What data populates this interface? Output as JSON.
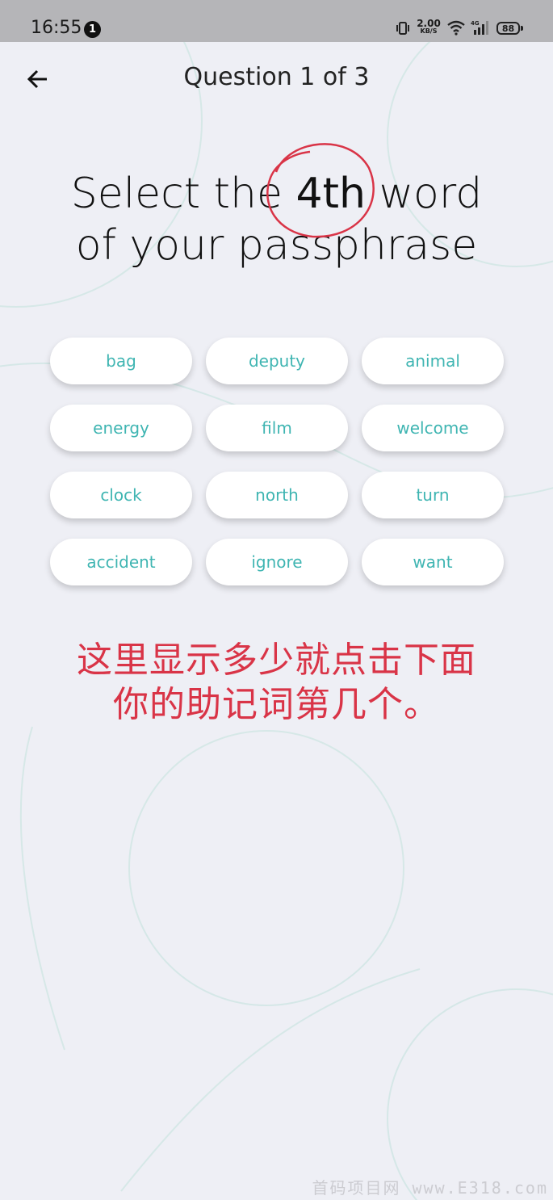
{
  "status_bar": {
    "time": "16:55",
    "notification_count": "1",
    "net_speed_value": "2.00",
    "net_speed_unit": "KB/S",
    "network_type": "4G",
    "battery_level": "88"
  },
  "header": {
    "title": "Question 1 of 3"
  },
  "instruction": {
    "prefix": "Select the",
    "ordinal": "4th",
    "suffix": "word",
    "line2": "of your passphrase"
  },
  "words": [
    "bag",
    "deputy",
    "animal",
    "energy",
    "film",
    "welcome",
    "clock",
    "north",
    "turn",
    "accident",
    "ignore",
    "want"
  ],
  "hint": {
    "line1": "这里显示多少就点击下面",
    "line2": "你的助记词第几个。"
  },
  "watermark": "首码项目网 www.E318.com",
  "colors": {
    "accent": "#3fb5b2",
    "hint_red": "#d93447",
    "background": "#eeeff5"
  }
}
